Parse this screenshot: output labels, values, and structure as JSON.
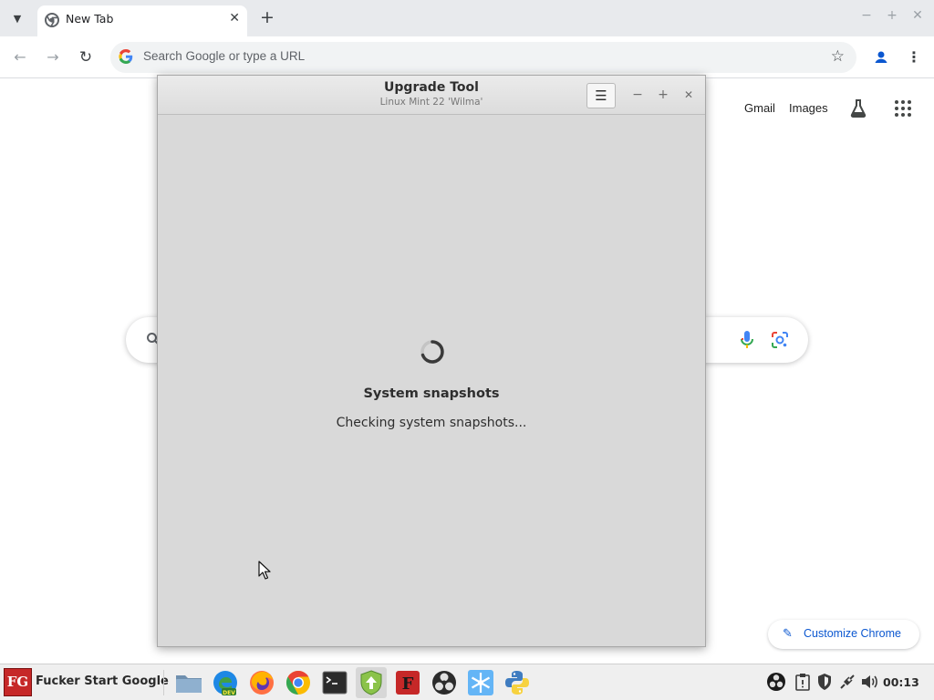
{
  "browser": {
    "tab_title": "New Tab",
    "tab_close": "✕",
    "new_tab": "+",
    "omnibox_placeholder": "Search Google or type a URL",
    "links": {
      "gmail": "Gmail",
      "images": "Images"
    },
    "customize_label": "Customize Chrome",
    "colors": {
      "accent": "#0b57d0",
      "tabstrip": "#e8eaed",
      "omnibox": "#f1f3f4"
    }
  },
  "dialog": {
    "title": "Upgrade Tool",
    "subtitle": "Linux Mint 22 'Wilma'",
    "menu_button": "☰",
    "status_heading": "System snapshots",
    "status_text": "Checking system snapshots...",
    "controls": {
      "minimize": "−",
      "maximize": "+",
      "close": "✕"
    }
  },
  "taskbar": {
    "start_icon_text": "FG",
    "start_label": "Fucker Start Google",
    "apps": [
      "folder-icon",
      "edge-dev-icon",
      "firefox-icon",
      "chrome-icon",
      "terminal-icon",
      "update-manager-icon",
      "font-manager-icon",
      "obs-icon",
      "snowflake-icon",
      "python-icon"
    ],
    "tray": [
      "obs-tray-icon",
      "clipboard-icon",
      "shield-icon",
      "network-icon",
      "volume-icon"
    ],
    "clock": "00:13"
  }
}
